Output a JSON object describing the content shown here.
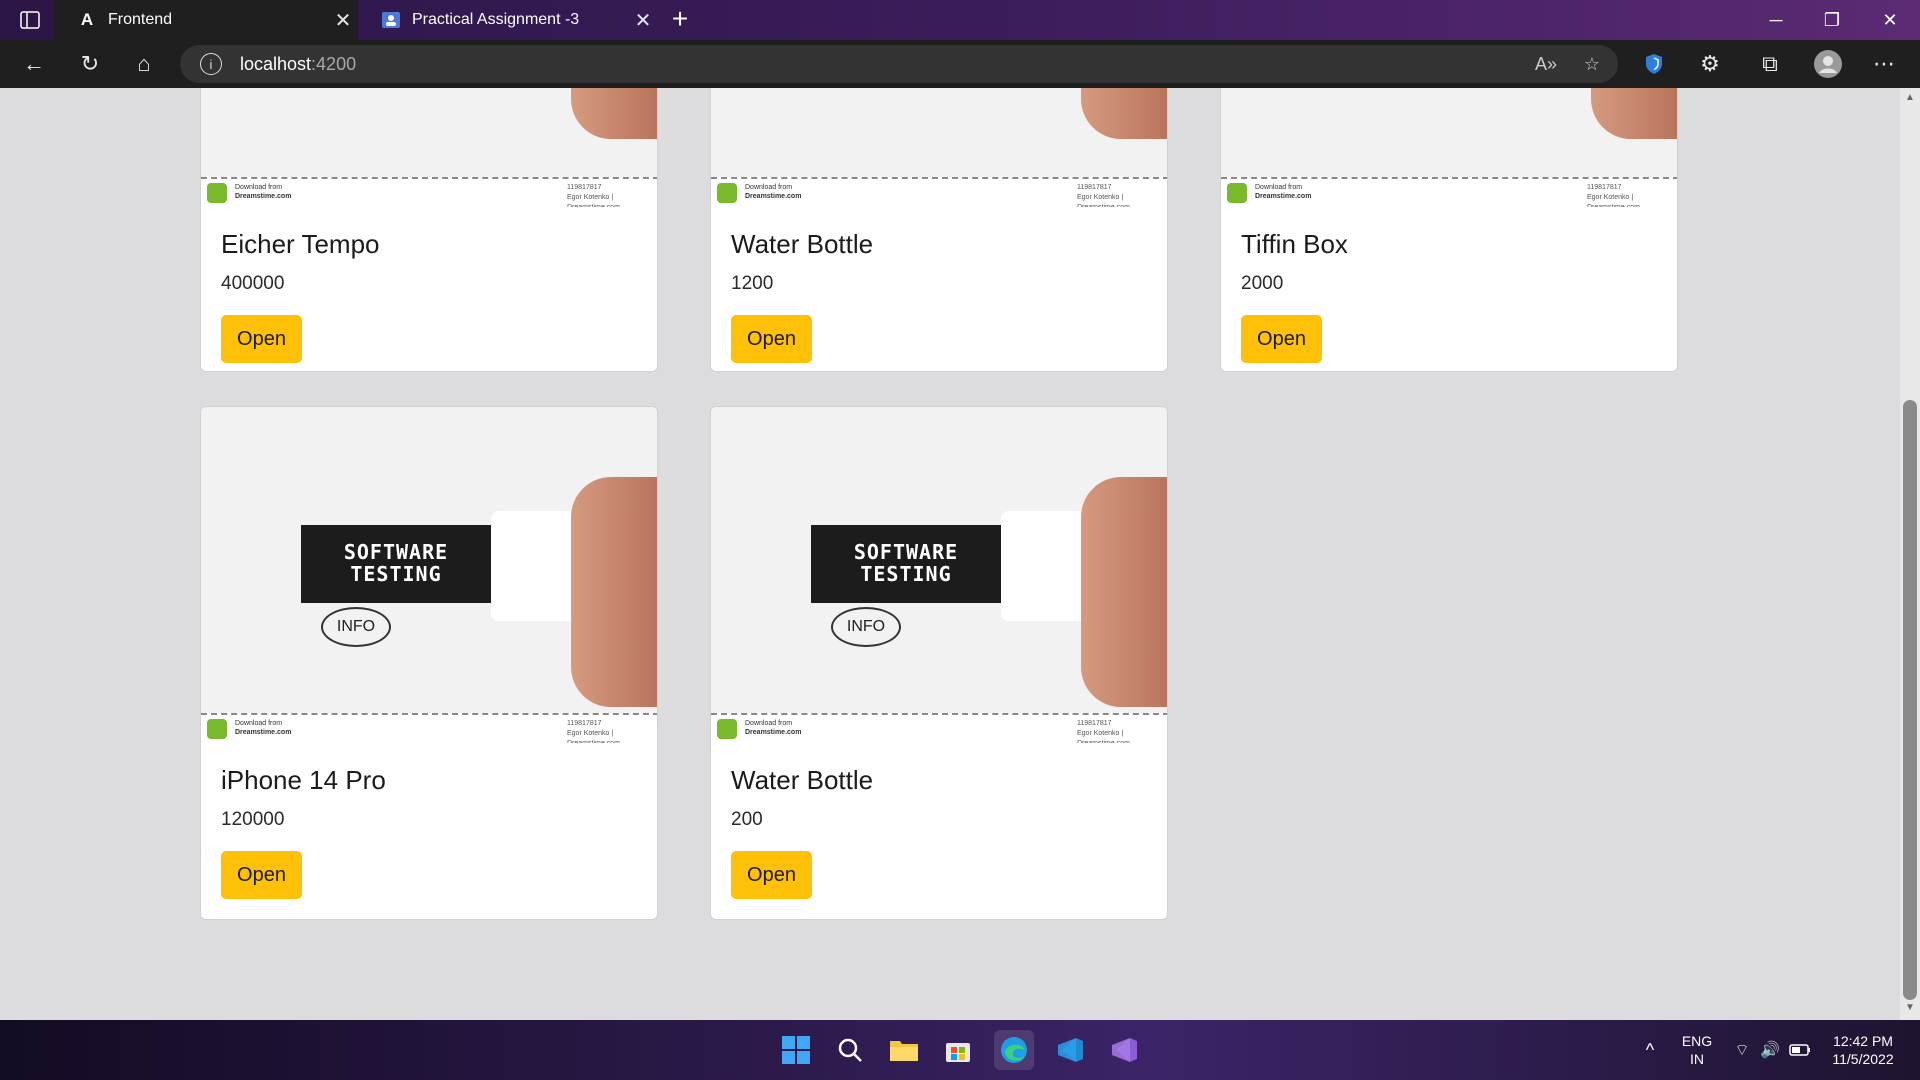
{
  "browser": {
    "tabs": [
      {
        "label": "Frontend",
        "icon": "angular-icon",
        "active": true
      },
      {
        "label": "Practical Assignment -3",
        "icon": "doc-icon",
        "active": false
      }
    ],
    "address": {
      "host": "localhost",
      "port": ":4200"
    }
  },
  "products": [
    {
      "title": "Eicher Tempo",
      "price": "400000",
      "button": "Open"
    },
    {
      "title": "Water Bottle",
      "price": "1200",
      "button": "Open"
    },
    {
      "title": "Tiffin Box",
      "price": "2000",
      "button": "Open"
    },
    {
      "title": "iPhone 14 Pro",
      "price": "120000",
      "button": "Open"
    },
    {
      "title": "Water Bottle",
      "price": "200",
      "button": "Open"
    }
  ],
  "image_text": {
    "banner": "SOFTWARE TESTING",
    "footer_download": "Download from",
    "footer_site": "Dreamstime.com",
    "footer_id": "119817817",
    "footer_credit": "Egor Kotenko | Dreamstime.com",
    "bubble": "INFO"
  },
  "taskbar": {
    "lang": "ENG",
    "region": "IN",
    "time": "12:42 PM",
    "date": "11/5/2022"
  },
  "colors": {
    "accent_button": "#ffc107",
    "page_bg": "#dcdcde"
  }
}
